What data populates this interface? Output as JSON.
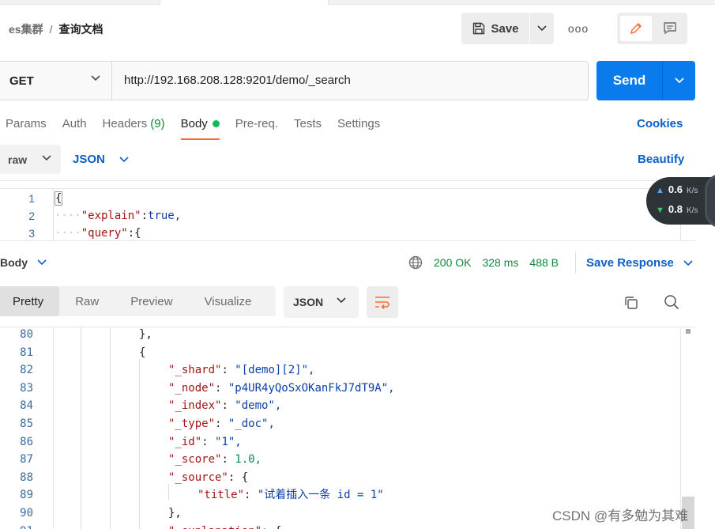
{
  "header": {
    "breadcrumb_parent": "es集群",
    "breadcrumb_sep": "/",
    "breadcrumb_current": "查询文档",
    "save_label": "Save",
    "more_label": "ooo"
  },
  "request": {
    "method": "GET",
    "url": "http://192.168.208.128:9201/demo/_search",
    "send_label": "Send",
    "tabs": [
      {
        "label": "Params"
      },
      {
        "label": "Auth"
      },
      {
        "label": "Headers",
        "count": "(9)"
      },
      {
        "label": "Body"
      },
      {
        "label": "Pre-req."
      },
      {
        "label": "Tests"
      },
      {
        "label": "Settings"
      }
    ],
    "cookies_label": "Cookies",
    "body_type": "raw",
    "body_format": "JSON",
    "beautify_label": "Beautify",
    "code_lines": [
      {
        "num": "1",
        "indent": "",
        "key": "",
        "sep": "",
        "value": "{"
      },
      {
        "num": "2",
        "indent": "····",
        "key": "\"explain\"",
        "sep": ":",
        "value": "true,"
      },
      {
        "num": "3",
        "indent": "····",
        "key": "\"query\"",
        "sep": ":",
        "value": "{"
      }
    ]
  },
  "speed_widget": {
    "up_value": "0.6",
    "up_unit": "K/s",
    "down_value": "0.8",
    "down_unit": "K/s"
  },
  "response": {
    "body_label": "Body",
    "status": "200 OK",
    "time": "328 ms",
    "size": "488 B",
    "save_response_label": "Save Response",
    "view_tabs": [
      "Pretty",
      "Raw",
      "Preview",
      "Visualize"
    ],
    "format": "JSON",
    "lines": [
      {
        "num": "80",
        "key": "",
        "sep": "",
        "value": "},",
        "level": 4
      },
      {
        "num": "81",
        "key": "",
        "sep": "",
        "value": "{",
        "level": 4
      },
      {
        "num": "82",
        "key": "\"_shard\"",
        "sep": ": ",
        "value": "\"[demo][2]\",",
        "level": 5
      },
      {
        "num": "83",
        "key": "\"_node\"",
        "sep": ": ",
        "value": "\"p4UR4yQoSxOKanFkJ7dT9A\",",
        "level": 5
      },
      {
        "num": "84",
        "key": "\"_index\"",
        "sep": ": ",
        "value": "\"demo\",",
        "level": 5
      },
      {
        "num": "85",
        "key": "\"_type\"",
        "sep": ": ",
        "value": "\"_doc\",",
        "level": 5
      },
      {
        "num": "86",
        "key": "\"_id\"",
        "sep": ": ",
        "value": "\"1\",",
        "level": 5
      },
      {
        "num": "87",
        "key": "\"_score\"",
        "sep": ": ",
        "value": "1.0,",
        "level": 5
      },
      {
        "num": "88",
        "key": "\"_source\"",
        "sep": ": ",
        "value": "{",
        "level": 5
      },
      {
        "num": "89",
        "key": "\"title\"",
        "sep": ": ",
        "value": "\"试着插入一条 id = 1\"",
        "level": 6
      },
      {
        "num": "90",
        "key": "",
        "sep": "",
        "value": "},",
        "level": 5
      },
      {
        "num": "91",
        "key": "\"_explanation\"",
        "sep": ": ",
        "value": "{",
        "level": 5
      }
    ]
  },
  "watermark": "CSDN @有多勉为其难"
}
